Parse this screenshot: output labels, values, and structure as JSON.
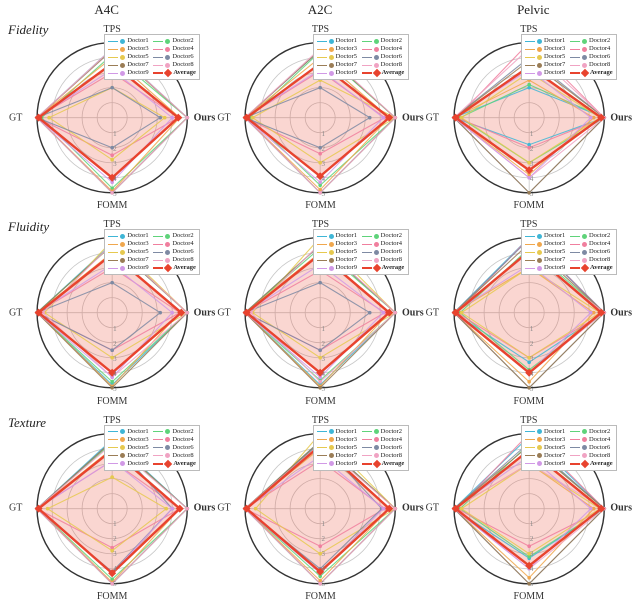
{
  "columns": [
    "A4C",
    "A2C",
    "Pelvic"
  ],
  "rows": [
    "Fidelity",
    "Fluidity",
    "Texture"
  ],
  "axes": [
    "TPS",
    "Ours",
    "FOMM",
    "GT"
  ],
  "axis_scale": {
    "min": 0,
    "max": 5,
    "ticks": [
      1,
      2,
      3,
      4,
      5
    ]
  },
  "legend_items": [
    {
      "name": "Doctor1",
      "color": "#3fb6d6"
    },
    {
      "name": "Doctor2",
      "color": "#5fd37a"
    },
    {
      "name": "Doctor3",
      "color": "#f0a74d"
    },
    {
      "name": "Doctor4",
      "color": "#f07f9e"
    },
    {
      "name": "Doctor5",
      "color": "#e6c94f"
    },
    {
      "name": "Doctor6",
      "color": "#7e8aa3"
    },
    {
      "name": "Doctor7",
      "color": "#9a7d56"
    },
    {
      "name": "Doctor8",
      "color": "#f0a3c3"
    },
    {
      "name": "Doctor9",
      "color": "#d199e6"
    },
    {
      "name": "Average",
      "color": "#e8432e",
      "style": "diamond-thick"
    }
  ],
  "chart_data": [
    {
      "row": "Fidelity",
      "col": "A4C",
      "type": "radar",
      "axes": [
        "TPS",
        "Ours",
        "FOMM",
        "GT"
      ],
      "series": [
        {
          "name": "Doctor1",
          "values": [
            4.6,
            5.0,
            5.0,
            5.0
          ]
        },
        {
          "name": "Doctor2",
          "values": [
            4.2,
            5.0,
            4.7,
            4.7
          ]
        },
        {
          "name": "Doctor3",
          "values": [
            4.0,
            4.5,
            4.9,
            5.0
          ]
        },
        {
          "name": "Doctor4",
          "values": [
            3.0,
            4.4,
            2.5,
            5.0
          ]
        },
        {
          "name": "Doctor5",
          "values": [
            2.0,
            3.5,
            2.8,
            4.2
          ]
        },
        {
          "name": "Doctor6",
          "values": [
            2.0,
            3.2,
            2.0,
            5.0
          ]
        },
        {
          "name": "Doctor7",
          "values": [
            4.5,
            5.0,
            5.0,
            5.0
          ]
        },
        {
          "name": "Doctor8",
          "values": [
            4.6,
            5.0,
            5.0,
            5.0
          ]
        },
        {
          "name": "Doctor9",
          "values": [
            3.2,
            4.0,
            4.3,
            5.0
          ]
        },
        {
          "name": "Average",
          "values": [
            3.6,
            4.4,
            4.0,
            4.9
          ]
        }
      ]
    },
    {
      "row": "Fidelity",
      "col": "A2C",
      "type": "radar",
      "axes": [
        "TPS",
        "Ours",
        "FOMM",
        "GT"
      ],
      "series": [
        {
          "name": "Doctor1",
          "values": [
            4.5,
            5.0,
            5.0,
            5.0
          ]
        },
        {
          "name": "Doctor2",
          "values": [
            4.4,
            5.0,
            4.5,
            4.7
          ]
        },
        {
          "name": "Doctor3",
          "values": [
            4.0,
            4.6,
            4.8,
            5.0
          ]
        },
        {
          "name": "Doctor4",
          "values": [
            3.1,
            4.3,
            2.4,
            5.0
          ]
        },
        {
          "name": "Doctor5",
          "values": [
            2.5,
            5.0,
            3.0,
            4.5
          ]
        },
        {
          "name": "Doctor6",
          "values": [
            2.0,
            3.3,
            2.0,
            5.0
          ]
        },
        {
          "name": "Doctor7",
          "values": [
            4.5,
            5.0,
            5.0,
            5.0
          ]
        },
        {
          "name": "Doctor8",
          "values": [
            4.6,
            5.0,
            5.0,
            5.0
          ]
        },
        {
          "name": "Doctor9",
          "values": [
            3.2,
            4.2,
            4.3,
            5.0
          ]
        },
        {
          "name": "Average",
          "values": [
            3.6,
            4.6,
            3.9,
            4.9
          ]
        }
      ]
    },
    {
      "row": "Fidelity",
      "col": "Pelvic",
      "type": "radar",
      "axes": [
        "TPS",
        "Ours",
        "FOMM",
        "GT"
      ],
      "series": [
        {
          "name": "Doctor1",
          "values": [
            2.0,
            5.0,
            1.8,
            5.0
          ]
        },
        {
          "name": "Doctor2",
          "values": [
            2.2,
            5.0,
            3.0,
            4.6
          ]
        },
        {
          "name": "Doctor3",
          "values": [
            2.5,
            4.3,
            3.8,
            5.0
          ]
        },
        {
          "name": "Doctor4",
          "values": [
            5.0,
            5.0,
            2.0,
            4.8
          ]
        },
        {
          "name": "Doctor5",
          "values": [
            3.0,
            4.7,
            3.0,
            4.5
          ]
        },
        {
          "name": "Doctor6",
          "values": [
            4.0,
            5.0,
            5.0,
            5.0
          ]
        },
        {
          "name": "Doctor7",
          "values": [
            3.8,
            5.0,
            5.0,
            5.0
          ]
        },
        {
          "name": "Doctor8",
          "values": [
            4.6,
            5.0,
            4.0,
            5.0
          ]
        },
        {
          "name": "Doctor9",
          "values": [
            3.2,
            4.1,
            4.0,
            5.0
          ]
        },
        {
          "name": "Average",
          "values": [
            3.4,
            4.8,
            3.5,
            4.9
          ]
        }
      ]
    },
    {
      "row": "Fluidity",
      "col": "A4C",
      "type": "radar",
      "axes": [
        "TPS",
        "Ours",
        "FOMM",
        "GT"
      ],
      "series": [
        {
          "name": "Doctor1",
          "values": [
            4.6,
            5.0,
            4.8,
            5.0
          ]
        },
        {
          "name": "Doctor2",
          "values": [
            4.5,
            5.0,
            4.6,
            5.0
          ]
        },
        {
          "name": "Doctor3",
          "values": [
            4.0,
            4.5,
            4.9,
            5.0
          ]
        },
        {
          "name": "Doctor4",
          "values": [
            3.0,
            4.5,
            2.5,
            5.0
          ]
        },
        {
          "name": "Doctor5",
          "values": [
            4.8,
            5.0,
            3.0,
            4.5
          ]
        },
        {
          "name": "Doctor6",
          "values": [
            2.0,
            3.2,
            2.5,
            5.0
          ]
        },
        {
          "name": "Doctor7",
          "values": [
            4.5,
            5.0,
            5.0,
            5.0
          ]
        },
        {
          "name": "Doctor8",
          "values": [
            4.6,
            5.0,
            4.3,
            4.6
          ]
        },
        {
          "name": "Doctor9",
          "values": [
            3.2,
            4.0,
            4.3,
            5.0
          ]
        },
        {
          "name": "Average",
          "values": [
            3.9,
            4.6,
            4.0,
            4.9
          ]
        }
      ]
    },
    {
      "row": "Fluidity",
      "col": "A2C",
      "type": "radar",
      "axes": [
        "TPS",
        "Ours",
        "FOMM",
        "GT"
      ],
      "series": [
        {
          "name": "Doctor1",
          "values": [
            4.5,
            5.0,
            4.8,
            5.0
          ]
        },
        {
          "name": "Doctor2",
          "values": [
            4.3,
            5.0,
            4.5,
            5.0
          ]
        },
        {
          "name": "Doctor3",
          "values": [
            4.0,
            4.6,
            4.9,
            5.0
          ]
        },
        {
          "name": "Doctor4",
          "values": [
            2.8,
            4.3,
            2.5,
            5.0
          ]
        },
        {
          "name": "Doctor5",
          "values": [
            5.0,
            5.0,
            3.0,
            4.5
          ]
        },
        {
          "name": "Doctor6",
          "values": [
            2.0,
            3.3,
            2.5,
            5.0
          ]
        },
        {
          "name": "Doctor7",
          "values": [
            4.5,
            5.0,
            5.0,
            5.0
          ]
        },
        {
          "name": "Doctor8",
          "values": [
            4.6,
            5.0,
            4.6,
            4.6
          ]
        },
        {
          "name": "Doctor9",
          "values": [
            3.2,
            4.2,
            4.3,
            5.0
          ]
        },
        {
          "name": "Average",
          "values": [
            3.9,
            4.6,
            4.0,
            4.9
          ]
        }
      ]
    },
    {
      "row": "Fluidity",
      "col": "Pelvic",
      "type": "radar",
      "axes": [
        "TPS",
        "Ours",
        "FOMM",
        "GT"
      ],
      "series": [
        {
          "name": "Doctor1",
          "values": [
            5.0,
            5.0,
            3.3,
            5.0
          ]
        },
        {
          "name": "Doctor2",
          "values": [
            4.3,
            5.0,
            3.8,
            4.6
          ]
        },
        {
          "name": "Doctor3",
          "values": [
            3.0,
            4.3,
            4.6,
            5.0
          ]
        },
        {
          "name": "Doctor4",
          "values": [
            5.0,
            5.0,
            3.0,
            4.8
          ]
        },
        {
          "name": "Doctor5",
          "values": [
            3.0,
            4.7,
            3.0,
            4.5
          ]
        },
        {
          "name": "Doctor6",
          "values": [
            4.9,
            5.0,
            5.0,
            5.0
          ]
        },
        {
          "name": "Doctor7",
          "values": [
            4.6,
            5.0,
            5.0,
            5.0
          ]
        },
        {
          "name": "Doctor8",
          "values": [
            4.0,
            5.0,
            4.0,
            5.0
          ]
        },
        {
          "name": "Doctor9",
          "values": [
            3.2,
            4.1,
            4.0,
            5.0
          ]
        },
        {
          "name": "Average",
          "values": [
            4.1,
            4.8,
            4.0,
            4.9
          ]
        }
      ]
    },
    {
      "row": "Texture",
      "col": "A4C",
      "type": "radar",
      "axes": [
        "TPS",
        "Ours",
        "FOMM",
        "GT"
      ],
      "series": [
        {
          "name": "Doctor1",
          "values": [
            4.6,
            5.0,
            5.0,
            5.0
          ]
        },
        {
          "name": "Doctor2",
          "values": [
            4.4,
            5.0,
            4.7,
            5.0
          ]
        },
        {
          "name": "Doctor3",
          "values": [
            4.0,
            4.5,
            4.9,
            5.0
          ]
        },
        {
          "name": "Doctor4",
          "values": [
            3.2,
            4.5,
            2.6,
            5.0
          ]
        },
        {
          "name": "Doctor5",
          "values": [
            2.1,
            3.6,
            2.8,
            4.3
          ]
        },
        {
          "name": "Doctor6",
          "values": [
            4.5,
            4.0,
            4.2,
            5.0
          ]
        },
        {
          "name": "Doctor7",
          "values": [
            4.5,
            5.0,
            5.0,
            5.0
          ]
        },
        {
          "name": "Doctor8",
          "values": [
            4.3,
            5.0,
            5.0,
            5.0
          ]
        },
        {
          "name": "Doctor9",
          "values": [
            3.2,
            4.0,
            4.3,
            5.0
          ]
        },
        {
          "name": "Average",
          "values": [
            3.9,
            4.5,
            4.3,
            4.9
          ]
        }
      ]
    },
    {
      "row": "Texture",
      "col": "A2C",
      "type": "radar",
      "axes": [
        "TPS",
        "Ours",
        "FOMM",
        "GT"
      ],
      "series": [
        {
          "name": "Doctor1",
          "values": [
            4.5,
            5.0,
            5.0,
            5.0
          ]
        },
        {
          "name": "Doctor2",
          "values": [
            4.4,
            5.0,
            4.5,
            5.0
          ]
        },
        {
          "name": "Doctor3",
          "values": [
            4.0,
            4.6,
            4.8,
            5.0
          ]
        },
        {
          "name": "Doctor4",
          "values": [
            3.2,
            4.3,
            2.5,
            5.0
          ]
        },
        {
          "name": "Doctor5",
          "values": [
            5.0,
            5.0,
            3.0,
            4.3
          ]
        },
        {
          "name": "Doctor6",
          "values": [
            4.4,
            4.1,
            4.0,
            5.0
          ]
        },
        {
          "name": "Doctor7",
          "values": [
            4.5,
            5.0,
            5.0,
            5.0
          ]
        },
        {
          "name": "Doctor8",
          "values": [
            4.3,
            5.0,
            5.0,
            5.0
          ]
        },
        {
          "name": "Doctor9",
          "values": [
            3.5,
            4.2,
            4.3,
            5.0
          ]
        },
        {
          "name": "Average",
          "values": [
            4.2,
            4.6,
            4.2,
            4.9
          ]
        }
      ]
    },
    {
      "row": "Texture",
      "col": "Pelvic",
      "type": "radar",
      "axes": [
        "TPS",
        "Ours",
        "FOMM",
        "GT"
      ],
      "series": [
        {
          "name": "Doctor1",
          "values": [
            4.8,
            5.0,
            3.3,
            5.0
          ]
        },
        {
          "name": "Doctor2",
          "values": [
            4.3,
            5.0,
            3.2,
            4.6
          ]
        },
        {
          "name": "Doctor3",
          "values": [
            3.0,
            4.3,
            4.6,
            5.0
          ]
        },
        {
          "name": "Doctor4",
          "values": [
            5.0,
            5.0,
            2.5,
            4.8
          ]
        },
        {
          "name": "Doctor5",
          "values": [
            3.0,
            4.7,
            3.0,
            4.5
          ]
        },
        {
          "name": "Doctor6",
          "values": [
            4.4,
            5.0,
            5.0,
            5.0
          ]
        },
        {
          "name": "Doctor7",
          "values": [
            4.2,
            5.0,
            5.0,
            5.0
          ]
        },
        {
          "name": "Doctor8",
          "values": [
            3.0,
            5.0,
            4.0,
            5.0
          ]
        },
        {
          "name": "Doctor9",
          "values": [
            3.5,
            4.1,
            4.0,
            5.0
          ]
        },
        {
          "name": "Average",
          "values": [
            3.9,
            4.8,
            3.8,
            4.9
          ]
        }
      ]
    }
  ]
}
